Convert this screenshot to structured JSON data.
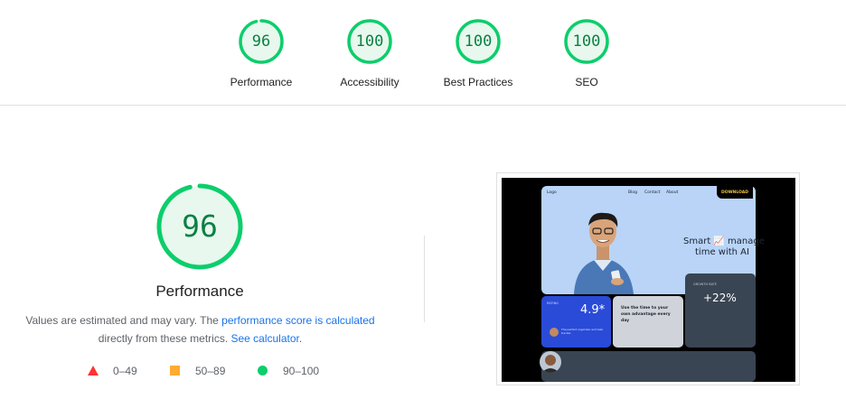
{
  "summary": {
    "gauges": [
      {
        "label": "Performance",
        "score": "96"
      },
      {
        "label": "Accessibility",
        "score": "100"
      },
      {
        "label": "Best Practices",
        "score": "100"
      },
      {
        "label": "SEO",
        "score": "100"
      }
    ]
  },
  "performance": {
    "score": "96",
    "title": "Performance",
    "desc_prefix": "Values are estimated and may vary. The ",
    "desc_link1": "performance score is calculated",
    "desc_middle": "directly from these metrics. ",
    "desc_link2": "See calculator",
    "desc_suffix": "."
  },
  "legend": [
    {
      "shape": "triangle",
      "range": "0–49",
      "color": "#ff3333"
    },
    {
      "shape": "square",
      "range": "50–89",
      "color": "#ffaa33"
    },
    {
      "shape": "circle",
      "range": "90–100",
      "color": "#0cce6b"
    }
  ],
  "thumbnail": {
    "nav_logo": "Logo",
    "nav_blog": "Blog",
    "nav_contact": "Contact",
    "nav_about": "About",
    "download": "DOWNLOAD",
    "headline_line1": "Smart 📈 manage",
    "headline_line2": "time with AI",
    "rating_small": "RATING",
    "rating_value": "4.9*",
    "rating_text": "The perfect organizer and task tracker.",
    "advantage_text": "Use the time to your own advantage every day",
    "growth_small": "GROWTH RATE",
    "growth_value": "+22%"
  },
  "colors": {
    "pass_green": "#0cce6b",
    "pass_text": "#0b8043",
    "pass_fill": "#e8f8ee",
    "link_blue": "#1a73e8"
  }
}
